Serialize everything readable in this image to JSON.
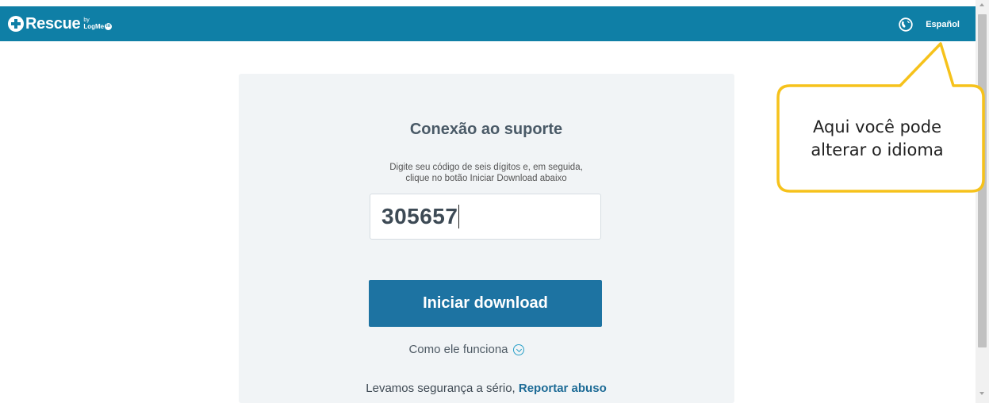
{
  "header": {
    "logo_word": "Rescue",
    "logo_by": "by",
    "logo_brand": "LogMe",
    "logo_badge": "in",
    "language_label": "Español",
    "icons": {
      "logo": "plus-circle-icon",
      "language": "globe-icon"
    }
  },
  "main": {
    "title": "Conexão ao suporte",
    "instruction_line1": "Digite seu código de seis dígitos e, em seguida,",
    "instruction_line2": "clique no botão Iniciar Download abaixo",
    "code_value": "305657",
    "download_button": "Iniciar download",
    "how_it_works": "Como ele funciona",
    "security_text": "Levamos segurança a sério,",
    "report_link": "Reportar abuso"
  },
  "callout": {
    "line1": "Aqui você pode",
    "line2": "alterar o idioma"
  },
  "colors": {
    "header_bg": "#0f7fa6",
    "button_bg": "#1d73a2",
    "card_bg": "#f1f4f6",
    "callout_border": "#f6c21b"
  }
}
